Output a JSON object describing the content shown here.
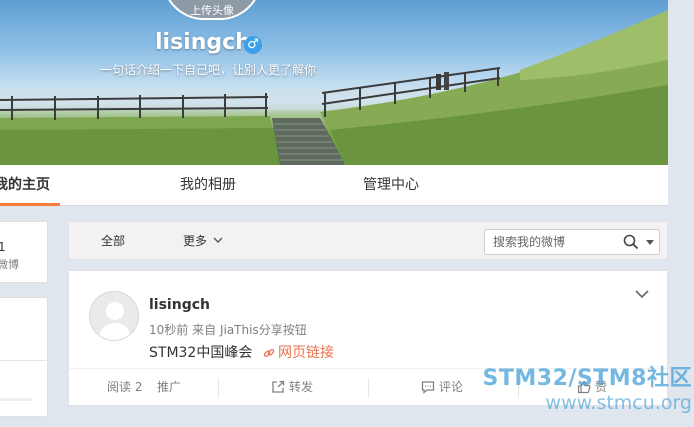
{
  "cover": {
    "avatar_upload_label": "上传头像",
    "profile_name": "lisingch",
    "gender_symbol": "♂",
    "bio": "一句话介绍一下自己吧，让别人更了解你"
  },
  "tabs": [
    {
      "label": "我的主页",
      "active": true
    },
    {
      "label": "我的相册",
      "active": false
    },
    {
      "label": "管理中心",
      "active": false
    }
  ],
  "sidebar": {
    "stat_number": "1",
    "stat_label": "微博"
  },
  "filter_bar": {
    "all_label": "全部",
    "more_label": "更多",
    "search_placeholder": "搜索我的微博"
  },
  "post": {
    "author": "lisingch",
    "time": "10秒前",
    "from_label": "来自",
    "source": "JiaThis分享按钮",
    "text": "STM32中国峰会",
    "link_label": "网页链接",
    "actions": {
      "read_label": "阅读",
      "read_count": "2",
      "promote_label": "推广",
      "repost_label": "转发",
      "comment_label": "评论",
      "like_label": "赞"
    }
  },
  "watermark": {
    "line1": "STM32/STM8社区",
    "line2": "www.stmcu.org"
  },
  "colors": {
    "accent": "#fa7d3c",
    "link": "#eb7350",
    "watermark": "#46a0d7"
  }
}
